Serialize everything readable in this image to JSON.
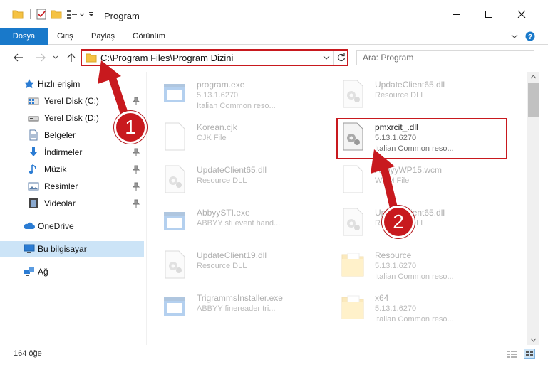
{
  "window": {
    "title": "Program",
    "controls": {
      "minimize": "minimize-icon",
      "maximize": "maximize-icon",
      "close": "close-icon"
    }
  },
  "ribbon": {
    "tabs": [
      "Dosya",
      "Giriş",
      "Paylaş",
      "Görünüm"
    ],
    "file_tab_color": "#1979ca"
  },
  "address": {
    "path": "C:\\Program Files\\Program Dizini",
    "search_placeholder": "Ara: Program"
  },
  "sidebar": {
    "quick_access": "Hızlı erişim",
    "items": [
      {
        "label": "Yerel Disk (C:)",
        "icon": "drive-c-icon",
        "pinned": true
      },
      {
        "label": "Yerel Disk (D:)",
        "icon": "drive-d-icon",
        "pinned": false
      },
      {
        "label": "Belgeler",
        "icon": "documents-icon",
        "pinned": true
      },
      {
        "label": "İndirmeler",
        "icon": "downloads-icon",
        "pinned": true
      },
      {
        "label": "Müzik",
        "icon": "music-icon",
        "pinned": true
      },
      {
        "label": "Resimler",
        "icon": "pictures-icon",
        "pinned": true
      },
      {
        "label": "Videolar",
        "icon": "videos-icon",
        "pinned": true
      }
    ],
    "onedrive": "OneDrive",
    "this_pc": "Bu bilgisayar",
    "network": "Ağ"
  },
  "files": [
    {
      "name": "program.exe",
      "line2": "5.13.1.6270",
      "line3": "Italian Common reso...",
      "icon": "exe-icon"
    },
    {
      "name": "UpdateClient65.dll",
      "line2": "Resource DLL",
      "line3": "",
      "icon": "dll-icon"
    },
    {
      "name": "Korean.cjk",
      "line2": "CJK File",
      "line3": "",
      "icon": "file-icon"
    },
    {
      "name": "pmxrcit_.dll",
      "line2": "5.13.1.6270",
      "line3": "Italian Common reso...",
      "icon": "dll-icon",
      "highlighted": true
    },
    {
      "name": "UpdateClient65.dll",
      "line2": "Resource DLL",
      "line3": "",
      "icon": "dll-icon"
    },
    {
      "name": "AbbyyWP15.wcm",
      "line2": "WCM File",
      "line3": "",
      "icon": "file-icon"
    },
    {
      "name": "AbbyySTI.exe",
      "line2": "ABBYY sti event hand...",
      "line3": "",
      "icon": "exe-icon"
    },
    {
      "name": "UpdateClient65.dll",
      "line2": "Resource DLL",
      "line3": "",
      "icon": "dll-icon"
    },
    {
      "name": "UpdateClient19.dll",
      "line2": "Resource DLL",
      "line3": "",
      "icon": "dll-icon"
    },
    {
      "name": "Resource",
      "line2": "5.13.1.6270",
      "line3": "Italian Common reso...",
      "icon": "folder-icon"
    },
    {
      "name": "TrigrammsInstaller.exe",
      "line2": "ABBYY finereader tri...",
      "line3": "",
      "icon": "exe-icon"
    },
    {
      "name": "x64",
      "line2": "5.13.1.6270",
      "line3": "Italian Common reso...",
      "icon": "folder-icon"
    }
  ],
  "status": {
    "count": "164 öğe"
  },
  "callouts": [
    "1",
    "2"
  ],
  "accent_red": "#c8191e"
}
